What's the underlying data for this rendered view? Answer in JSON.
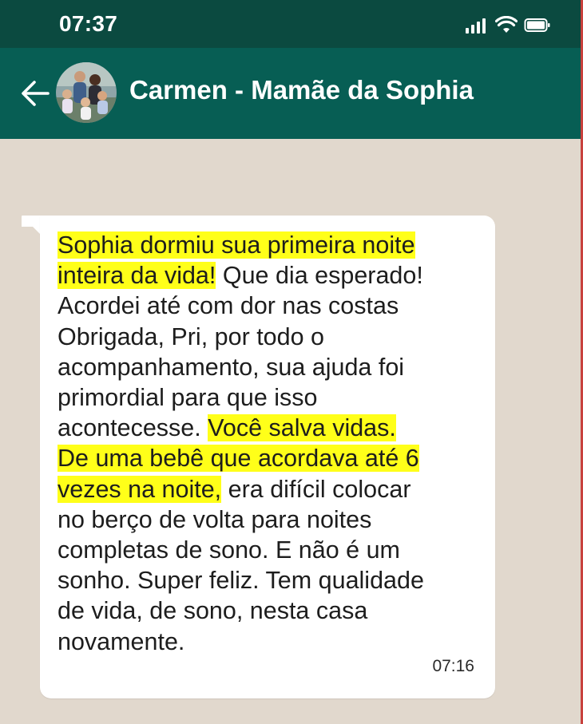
{
  "status_bar": {
    "time": "07:37",
    "icons": [
      "signal-icon",
      "wifi-icon",
      "battery-icon"
    ]
  },
  "header": {
    "back_icon": "arrow-left-icon",
    "contact_name": "Carmen - Mamãe da Sophia"
  },
  "message": {
    "segments": [
      {
        "text": "Sophia dormiu sua primeira noite",
        "highlight": true
      },
      {
        "text": "inteira da vida!",
        "highlight": true
      },
      {
        "text": " Que dia esperado!",
        "highlight": false
      },
      {
        "text": "Acordei até com dor nas costas",
        "highlight": false
      },
      {
        "text": "Obrigada, Pri, por todo o",
        "highlight": false
      },
      {
        "text": "acompanhamento, sua ajuda foi",
        "highlight": false
      },
      {
        "text": "primordial para que isso",
        "highlight": false
      },
      {
        "text": "acontecesse. ",
        "highlight": false
      },
      {
        "text": "Você salva vidas.",
        "highlight": true
      },
      {
        "text": "De uma bebê que acordava até 6",
        "highlight": true
      },
      {
        "text": "vezes na noite,",
        "highlight": true
      },
      {
        "text": " era difícil colocar",
        "highlight": false
      },
      {
        "text": "no berço de volta para noites",
        "highlight": false
      },
      {
        "text": "completas de sono. E não é um",
        "highlight": false
      },
      {
        "text": "sonho. Super feliz. Tem qualidade",
        "highlight": false
      },
      {
        "text": "de vida, de sono, nesta casa",
        "highlight": false
      },
      {
        "text": "novamente.",
        "highlight": false
      }
    ],
    "time": "07:16"
  },
  "colors": {
    "status_bar": "#0b4a40",
    "header": "#075e54",
    "chat_background": "#e1d8cd",
    "bubble": "#ffffff",
    "highlight": "#ffff19"
  }
}
